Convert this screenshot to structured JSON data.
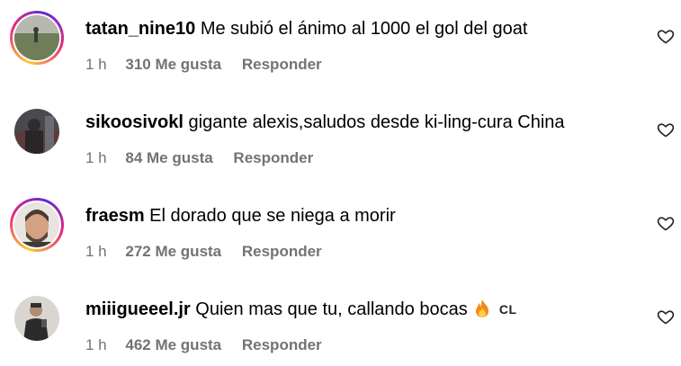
{
  "comments": [
    {
      "username": "tatan_nine10",
      "text": "Me subió el ánimo al 1000 el gol del goat",
      "time": "1 h",
      "likes": "310 Me gusta",
      "reply_label": "Responder",
      "has_story_ring": true
    },
    {
      "username": "sikoosivokl",
      "text": "gigante alexis,saludos desde ki-ling-cura China",
      "time": "1 h",
      "likes": "84 Me gusta",
      "reply_label": "Responder",
      "has_story_ring": false
    },
    {
      "username": "fraesm",
      "text": "El dorado que se niega a morir",
      "time": "1 h",
      "likes": "272 Me gusta",
      "reply_label": "Responder",
      "has_story_ring": true
    },
    {
      "username": "miiigueeel.jr",
      "text": "Quien mas que tu, callando bocas",
      "emoji": "fire-emoji",
      "tag": "CL",
      "time": "1 h",
      "likes": "462 Me gusta",
      "reply_label": "Responder",
      "has_story_ring": false
    }
  ],
  "icons": {
    "like": "heart-outline-icon",
    "fire": "fire-emoji"
  },
  "colors": {
    "meta_text": "#737373",
    "story_ring_start": "#f9ce34",
    "story_ring_mid": "#ee2a7b",
    "story_ring_end": "#6228d7"
  }
}
